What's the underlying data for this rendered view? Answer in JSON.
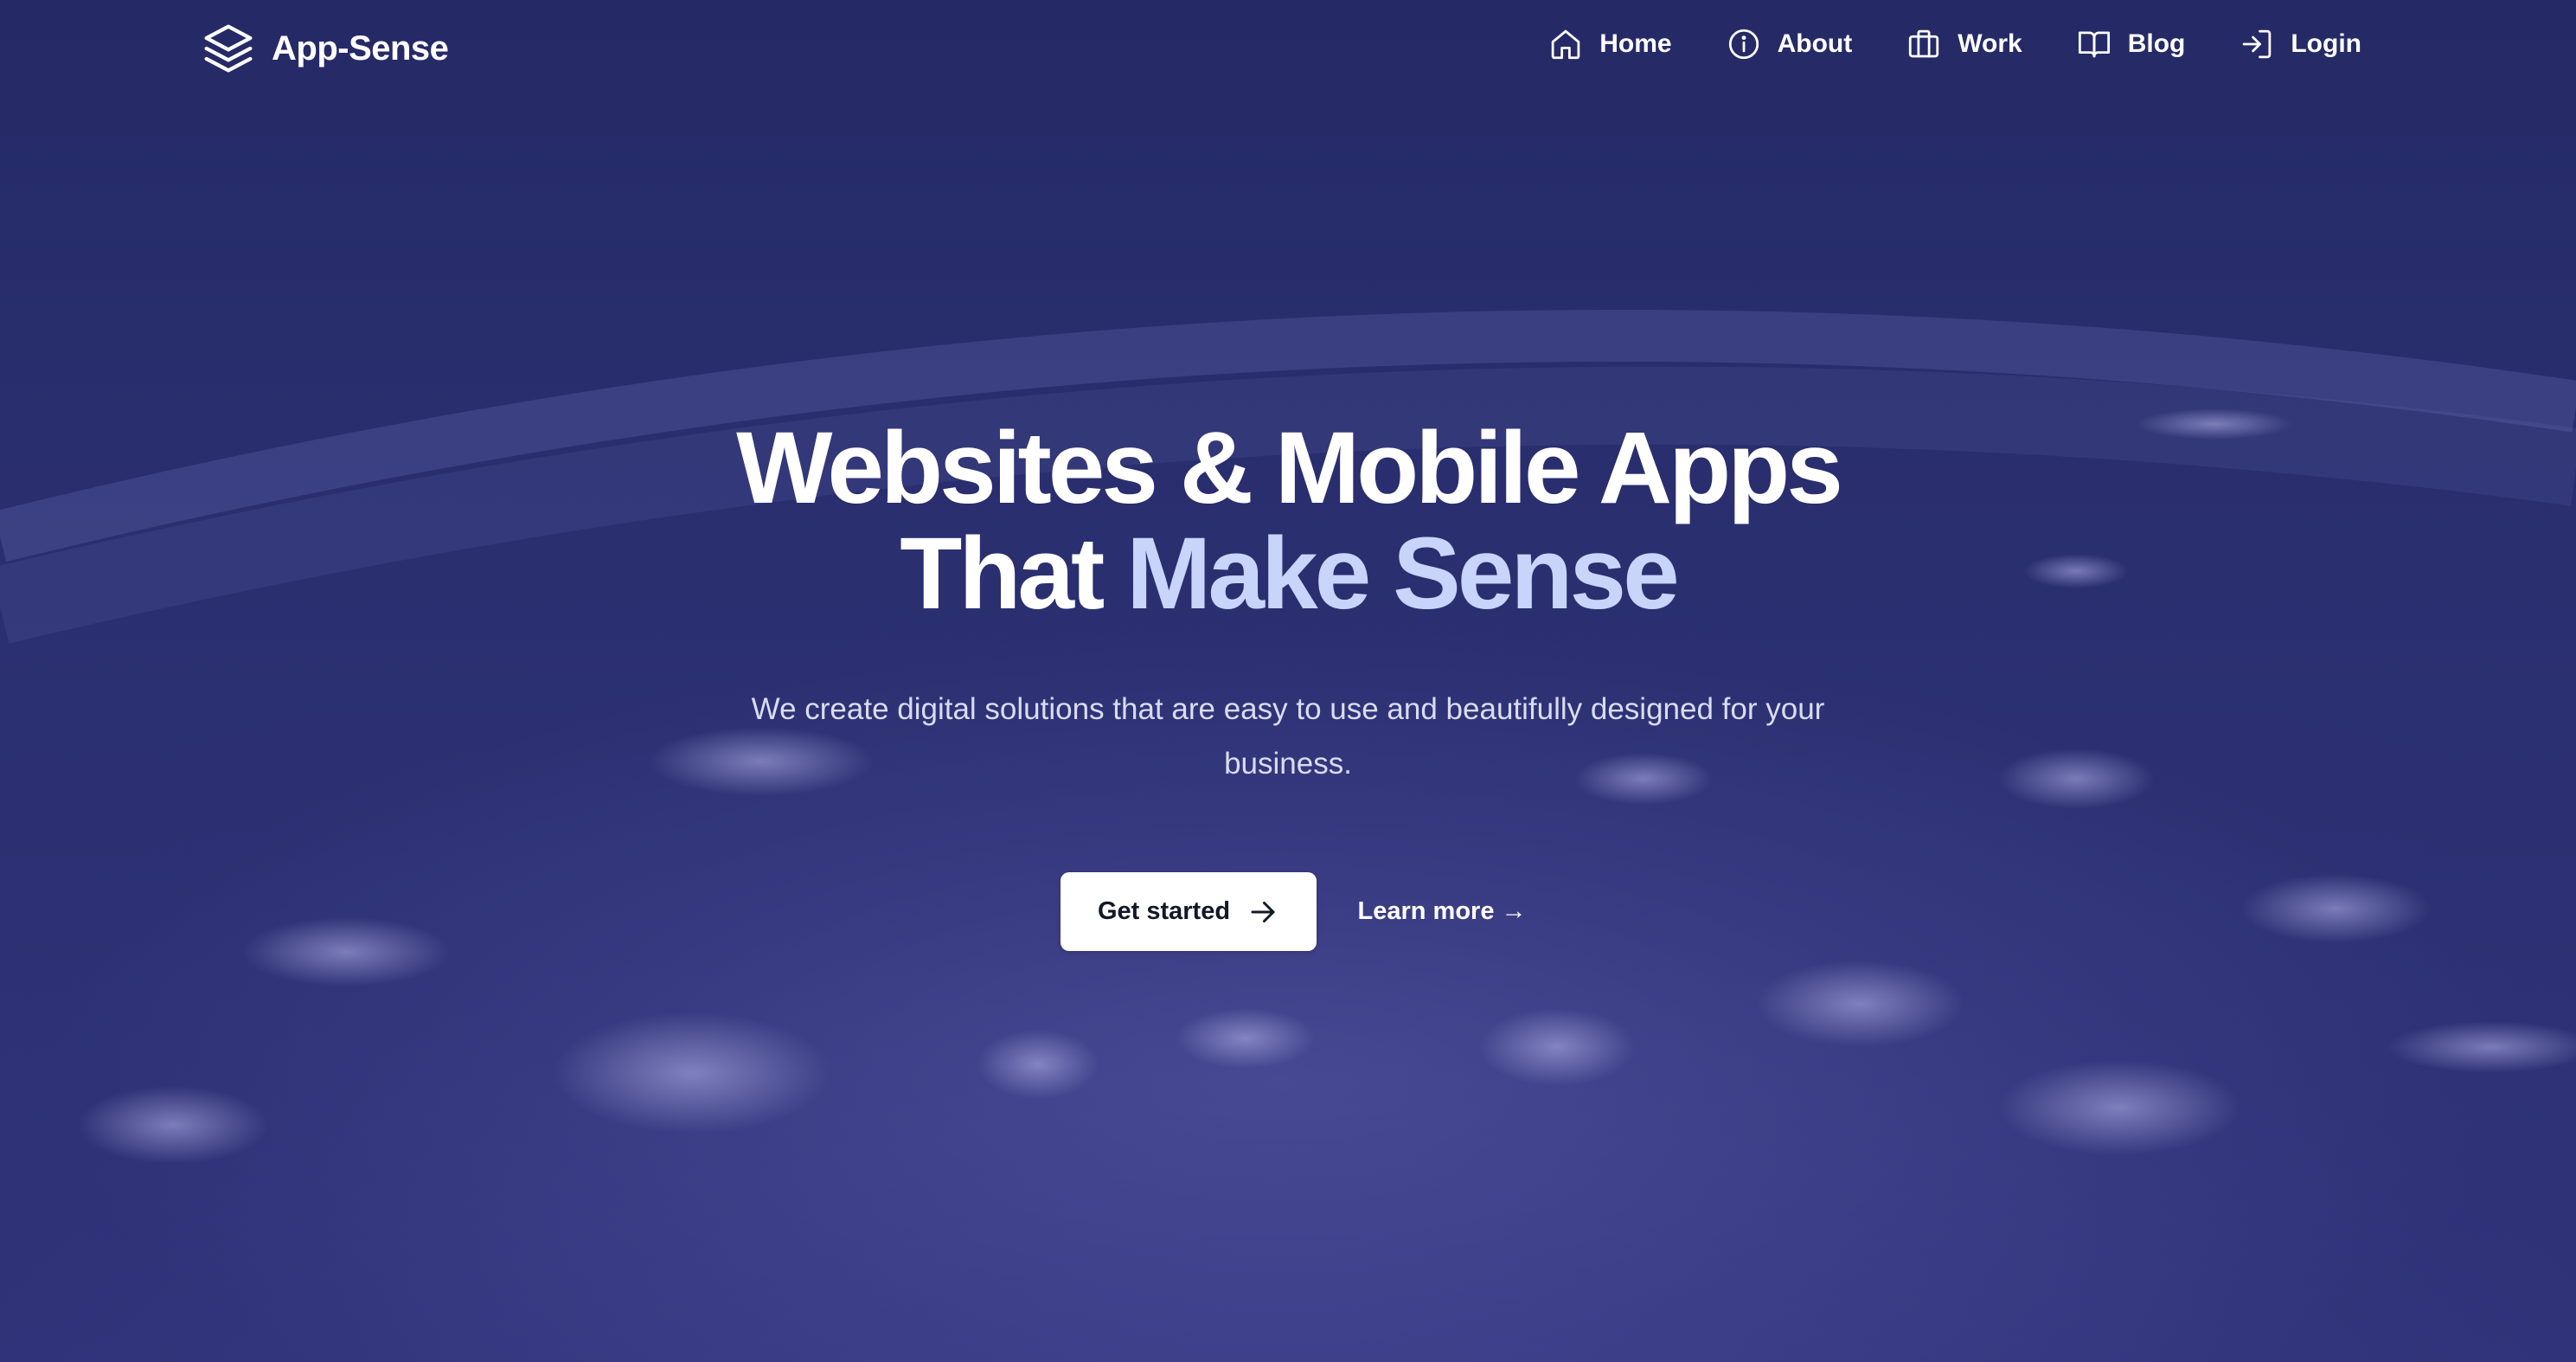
{
  "brand": {
    "name": "App-Sense",
    "logo_icon": "stacked-layers-icon"
  },
  "nav": {
    "items": [
      {
        "label": "Home",
        "icon": "home-icon"
      },
      {
        "label": "About",
        "icon": "info-icon"
      },
      {
        "label": "Work",
        "icon": "briefcase-icon"
      },
      {
        "label": "Blog",
        "icon": "book-open-icon"
      },
      {
        "label": "Login",
        "icon": "login-icon"
      }
    ]
  },
  "hero": {
    "title_line1": "Websites & Mobile Apps",
    "title_line2_plain": "That ",
    "title_line2_accent": "Make Sense",
    "subtitle": "We create digital solutions that are easy to use and beautifully designed for your business.",
    "primary_cta": "Get started",
    "secondary_cta": "Learn more →"
  },
  "colors": {
    "background": "#2a2e6b",
    "accent_text": "#c9d4fb",
    "primary_button_bg": "#ffffff",
    "primary_button_text": "#111827"
  }
}
